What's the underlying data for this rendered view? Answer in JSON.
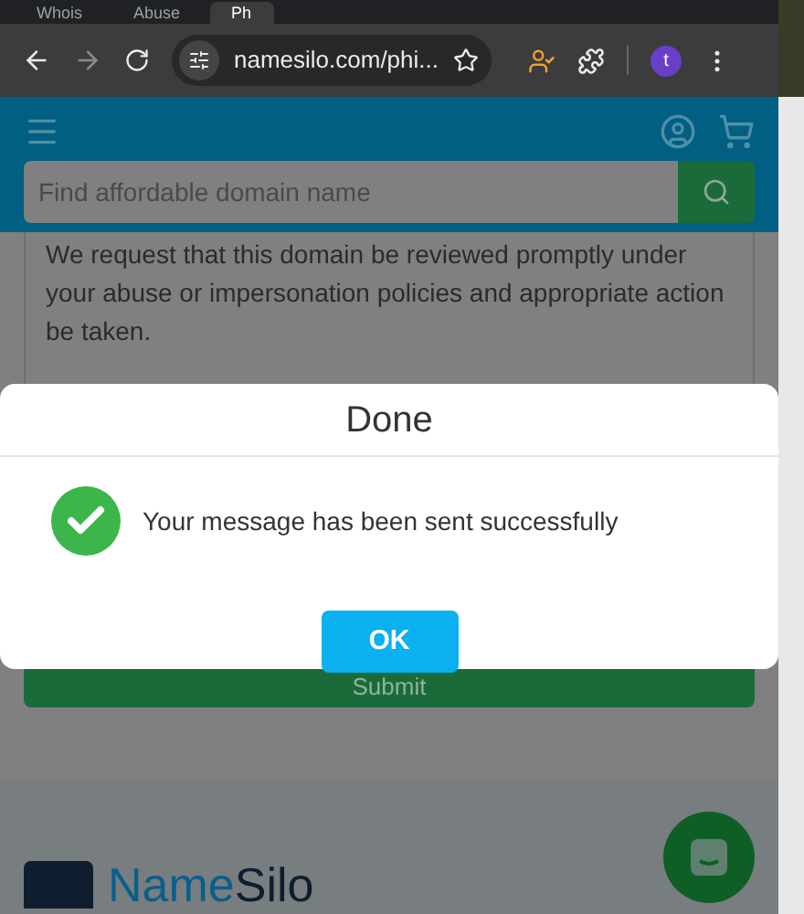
{
  "browser": {
    "tabs": [
      {
        "title": "Whois",
        "selected": false
      },
      {
        "title": "Abuse",
        "selected": false
      },
      {
        "title": "Ph",
        "selected": true
      }
    ],
    "url": "namesilo.com/phi...",
    "profile_initial": "t"
  },
  "site": {
    "search": {
      "placeholder": "Find affordable domain name"
    },
    "message_text": "We request that this domain be reviewed promptly under your abuse or impersonation policies and appropriate action be taken.",
    "submit_label": "Submit",
    "logo": {
      "first": "Name",
      "second": "Silo"
    }
  },
  "dialog": {
    "title": "Done",
    "message": "Your message has been sent successfully",
    "ok_label": "OK"
  }
}
